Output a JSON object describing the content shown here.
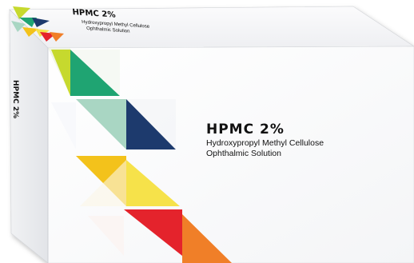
{
  "product": {
    "name": "HPMC 2%",
    "line1": "Hydroxypropyl Methyl Cellulose",
    "line2": "Ophthalmic Solution"
  },
  "side_panel": {
    "name": "HPMC 2%"
  },
  "colors": {
    "lime": "#c6d92e",
    "green": "#1fa472",
    "pale_green": "#a9d6c3",
    "navy": "#1d3a6d",
    "yellow": "#f3c21b",
    "light_yellow": "#f6e24a",
    "red": "#e4232c",
    "orange": "#f07f28"
  }
}
